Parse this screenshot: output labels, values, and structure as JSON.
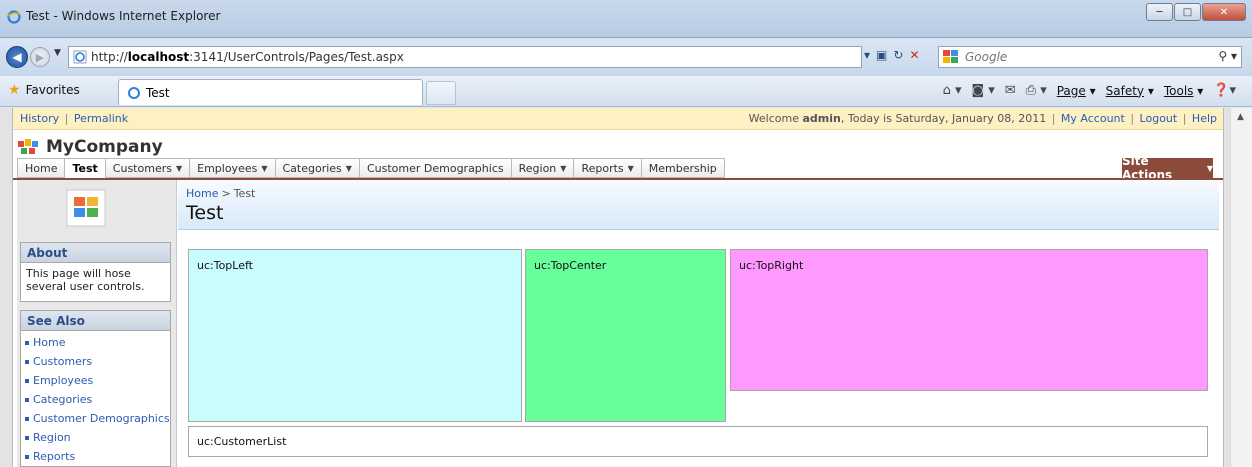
{
  "window": {
    "title": "Test - Windows Internet Explorer",
    "buttons": {
      "minimize": "─",
      "maximize": "□",
      "close": "✕"
    }
  },
  "address": {
    "url_prefix": "http://",
    "url_host": "localhost",
    "url_rest": ":3141/UserControls/Pages/Test.aspx",
    "search_placeholder": "Google"
  },
  "favorites_bar": {
    "favorites_label": "Favorites",
    "active_tab": "Test",
    "commands": [
      "Page",
      "Safety",
      "Tools"
    ]
  },
  "page": {
    "topbar": {
      "left_links": [
        "History",
        "Permalink"
      ],
      "welcome_prefix": "Welcome ",
      "welcome_user": "admin",
      "welcome_suffix": ", Today is Saturday, January 08, 2011",
      "right_links": [
        "My Account",
        "Logout",
        "Help"
      ]
    },
    "brand": "MyCompany",
    "menu": [
      {
        "label": "Home",
        "dropdown": false,
        "active": false
      },
      {
        "label": "Test",
        "dropdown": false,
        "active": true
      },
      {
        "label": "Customers",
        "dropdown": true,
        "active": false
      },
      {
        "label": "Employees",
        "dropdown": true,
        "active": false
      },
      {
        "label": "Categories",
        "dropdown": true,
        "active": false
      },
      {
        "label": "Customer Demographics",
        "dropdown": false,
        "active": false
      },
      {
        "label": "Region",
        "dropdown": true,
        "active": false
      },
      {
        "label": "Reports",
        "dropdown": true,
        "active": false
      },
      {
        "label": "Membership",
        "dropdown": false,
        "active": false
      }
    ],
    "site_actions": "Site Actions",
    "sidebar": {
      "about_title": "About",
      "about_text": "This page will hose several user controls.",
      "see_also_title": "See Also",
      "see_also_links": [
        "Home",
        "Customers",
        "Employees",
        "Categories",
        "Customer Demographics",
        "Region",
        "Reports"
      ]
    },
    "breadcrumb": {
      "home": "Home",
      "separator": ">",
      "current": "Test"
    },
    "title": "Test",
    "controls": {
      "top_left": "uc:TopLeft",
      "top_center": "uc:TopCenter",
      "top_right": "uc:TopRight",
      "customer_list": "uc:CustomerList"
    }
  },
  "colors": {
    "top_left_bg": "#c9fcfc",
    "top_center_bg": "#66ff99",
    "top_right_bg": "#ff99ff",
    "site_actions_bg": "#8b4a3a",
    "topbar_bg": "#fdf0c3"
  }
}
